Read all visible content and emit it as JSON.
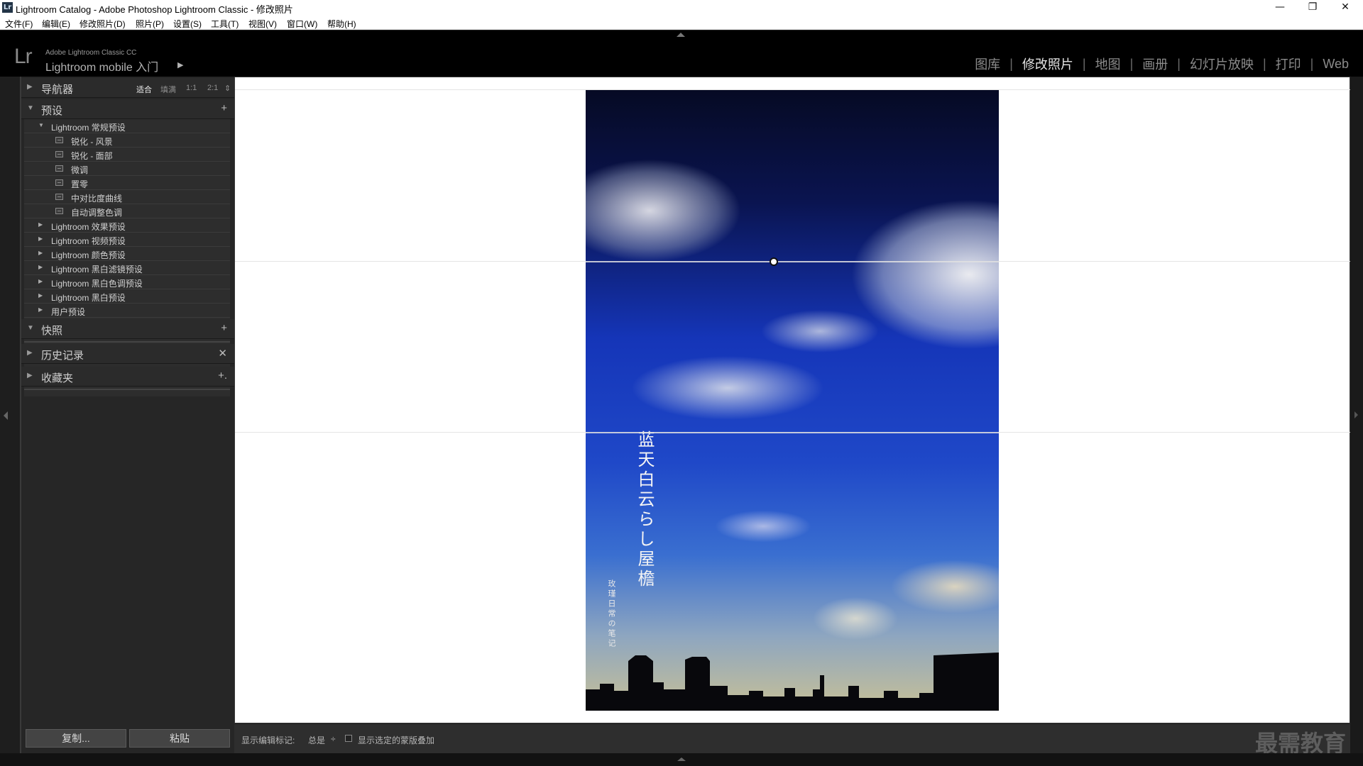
{
  "window": {
    "title": "Lightroom Catalog - Adobe Photoshop Lightroom Classic - 修改照片",
    "app_icon": "Lr",
    "controls": {
      "minimize": "—",
      "restore": "❐",
      "close": "✕"
    }
  },
  "menubar": {
    "items": [
      "文件(F)",
      "编辑(E)",
      "修改照片(D)",
      "照片(P)",
      "设置(S)",
      "工具(T)",
      "视图(V)",
      "窗口(W)",
      "帮助(H)"
    ]
  },
  "header": {
    "logo": "Lr",
    "product_small": "Adobe Lightroom Classic CC",
    "product_main": "Lightroom mobile 入门",
    "product_arrow": "▶",
    "modules": [
      {
        "label": "图库",
        "active": false
      },
      {
        "label": "修改照片",
        "active": true
      },
      {
        "label": "地图",
        "active": false
      },
      {
        "label": "画册",
        "active": false
      },
      {
        "label": "幻灯片放映",
        "active": false
      },
      {
        "label": "打印",
        "active": false
      },
      {
        "label": "Web",
        "active": false
      }
    ],
    "separator": "|"
  },
  "left_panel": {
    "navigator": {
      "title": "导航器",
      "zoom_options": [
        "适合",
        "填满",
        "1:1",
        "2:1"
      ],
      "active_zoom": "适合",
      "zoom_menu_icon": "⇕"
    },
    "presets": {
      "title": "预设",
      "action": "+",
      "groups": [
        {
          "label": "Lightroom 常规预设",
          "expanded": true
        },
        {
          "label": "锐化 - 风景",
          "child": true
        },
        {
          "label": "锐化 - 面部",
          "child": true
        },
        {
          "label": "微调",
          "child": true
        },
        {
          "label": "置零",
          "child": true
        },
        {
          "label": "中对比度曲线",
          "child": true
        },
        {
          "label": "自动调整色调",
          "child": true
        },
        {
          "label": "Lightroom 效果预设",
          "expanded": false
        },
        {
          "label": "Lightroom 视频预设",
          "expanded": false
        },
        {
          "label": "Lightroom 颜色预设",
          "expanded": false
        },
        {
          "label": "Lightroom 黑白滤镜预设",
          "expanded": false
        },
        {
          "label": "Lightroom 黑白色调预设",
          "expanded": false
        },
        {
          "label": "Lightroom 黑白预设",
          "expanded": false
        },
        {
          "label": "用户预设",
          "expanded": false
        }
      ]
    },
    "snapshots": {
      "title": "快照",
      "action": "+"
    },
    "history": {
      "title": "历史记录",
      "action": "✕"
    },
    "collections": {
      "title": "收藏夹",
      "action": "+."
    },
    "copy_button": "复制...",
    "paste_button": "粘贴"
  },
  "photo": {
    "vertical_title": "蓝天白云らし屋檐",
    "vertical_subtitle": "玫瑾日常の笔记"
  },
  "toolbar": {
    "show_pins_label": "显示编辑标记:",
    "show_pins_value": "总是",
    "show_pins_arrow": "÷",
    "overlay_label": "显示选定的蒙版叠加",
    "overlay_checked": false
  },
  "watermark": "最需教育",
  "colors": {
    "active_module": "#e6e6e6",
    "inactive_module": "#8c8c8c",
    "panel_bg": "#262626"
  }
}
